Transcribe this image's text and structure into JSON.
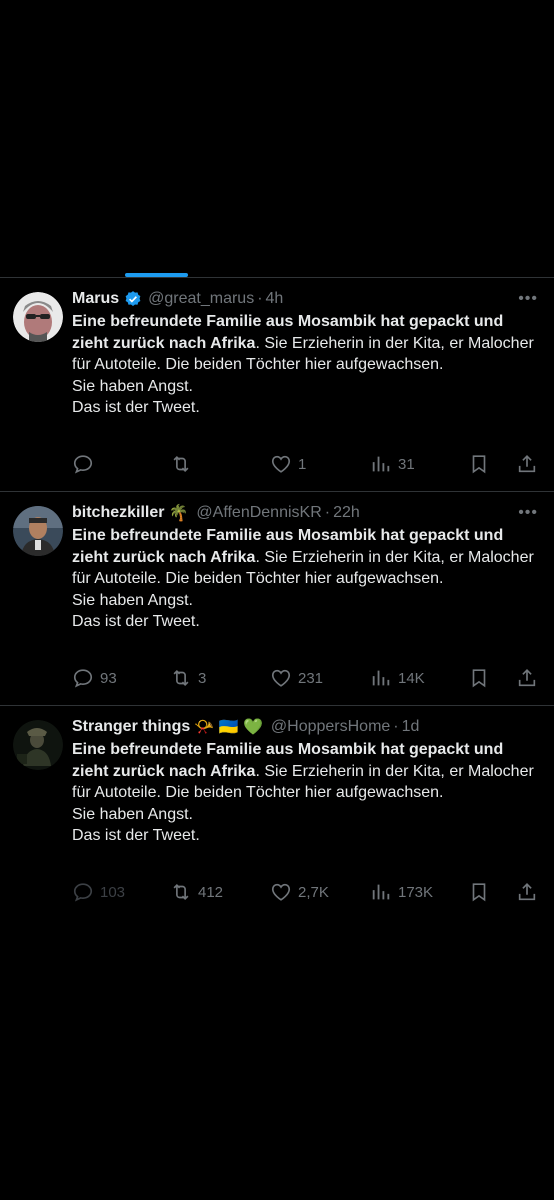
{
  "tweets": [
    {
      "name": "Marus",
      "verified": true,
      "emoji": "",
      "handle": "@great_marus",
      "time": "4h",
      "bold_text": "Eine befreundete Familie aus Mosambik hat gepackt und zieht zurück nach Afrika",
      "rest_text": ". Sie Erzieherin in der Kita, er Malocher für Autoteile. Die beiden Töchter hier aufgewachsen.",
      "line2": "Sie haben Angst.",
      "line3": "Das ist der Tweet.",
      "replies": "",
      "retweets": "",
      "likes": "1",
      "views": "31"
    },
    {
      "name": "bitchezkiller",
      "verified": false,
      "emoji": "🌴",
      "handle": "@AffenDennisKR",
      "time": "22h",
      "bold_text": "Eine befreundete Familie aus Mosambik hat gepackt und zieht zurück nach Afrika",
      "rest_text": ". Sie Erzieherin in der Kita, er Malocher für Autoteile. Die beiden Töchter hier aufgewachsen.",
      "line2": "Sie haben Angst.",
      "line3": "Das ist der Tweet.",
      "replies": "93",
      "retweets": "3",
      "likes": "231",
      "views": "14K"
    },
    {
      "name": "Stranger things",
      "verified": false,
      "emoji": "📯 🇺🇦 💚",
      "handle": "@HoppersHome",
      "time": "1d",
      "bold_text": "Eine befreundete Familie aus Mosambik hat gepackt und zieht zurück nach Afrika",
      "rest_text": ". Sie Erzieherin in der Kita, er Malocher für Autoteile. Die beiden Töchter hier aufgewachsen.",
      "line2": "Sie haben Angst.",
      "line3": "Das ist der Tweet.",
      "replies": "103",
      "retweets": "412",
      "likes": "2,7K",
      "views": "173K"
    }
  ],
  "more_label": "•••",
  "separator": "·",
  "colors": {
    "accent": "#1d9bf0",
    "text": "#e7e9ea",
    "muted": "#71767b",
    "border": "#2f3336",
    "background": "#000000"
  }
}
